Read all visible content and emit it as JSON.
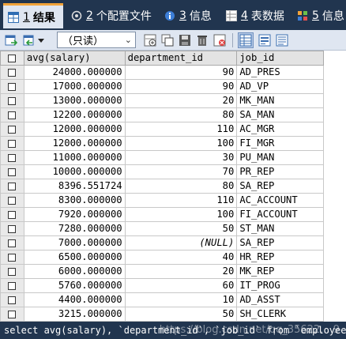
{
  "tabs": [
    {
      "num": "1",
      "label": "结果",
      "icon": "grid-result-icon",
      "active": true
    },
    {
      "num": "2",
      "label": "个配置文件",
      "icon": "profile-icon",
      "active": false
    },
    {
      "num": "3",
      "label": "信息",
      "icon": "info-icon",
      "active": false
    },
    {
      "num": "4",
      "label": "表数据",
      "icon": "table-data-icon",
      "active": false
    },
    {
      "num": "5",
      "label": "信息",
      "icon": "info-icon",
      "active": false
    }
  ],
  "toolbar": {
    "mode": "（只读）",
    "icons": [
      "export-icon",
      "import-icon",
      "dropdown-icon",
      "insert-row-icon",
      "duplicate-row-icon",
      "save-icon",
      "delete-icon",
      "cancel-icon",
      "grid-view-icon",
      "form-view-icon",
      "text-view-icon"
    ]
  },
  "table": {
    "columns": [
      "avg(salary)",
      "department_id",
      "job_id"
    ],
    "rows": [
      [
        "24000.000000",
        "90",
        "AD_PRES"
      ],
      [
        "17000.000000",
        "90",
        "AD_VP"
      ],
      [
        "13000.000000",
        "20",
        "MK_MAN"
      ],
      [
        "12200.000000",
        "80",
        "SA_MAN"
      ],
      [
        "12000.000000",
        "110",
        "AC_MGR"
      ],
      [
        "12000.000000",
        "100",
        "FI_MGR"
      ],
      [
        "11000.000000",
        "30",
        "PU_MAN"
      ],
      [
        "10000.000000",
        "70",
        "PR_REP"
      ],
      [
        "8396.551724",
        "80",
        "SA_REP"
      ],
      [
        "8300.000000",
        "110",
        "AC_ACCOUNT"
      ],
      [
        "7920.000000",
        "100",
        "FI_ACCOUNT"
      ],
      [
        "7280.000000",
        "50",
        "ST_MAN"
      ],
      [
        "7000.000000",
        "(NULL)",
        "SA_REP"
      ],
      [
        "6500.000000",
        "40",
        "HR_REP"
      ],
      [
        "6000.000000",
        "20",
        "MK_REP"
      ],
      [
        "5760.000000",
        "60",
        "IT_PROG"
      ],
      [
        "4400.000000",
        "10",
        "AD_ASST"
      ],
      [
        "3215.000000",
        "50",
        "SH_CLERK"
      ]
    ]
  },
  "status": {
    "query": "select avg(salary), `department_id`, `job_id`  from  `employees`",
    "watermark": "https://blog.csdn.net/qq_35622... 9"
  },
  "colors": {
    "accent": "#f2a33a",
    "bar": "#21354f",
    "toolbar": "#dfe6f1"
  }
}
